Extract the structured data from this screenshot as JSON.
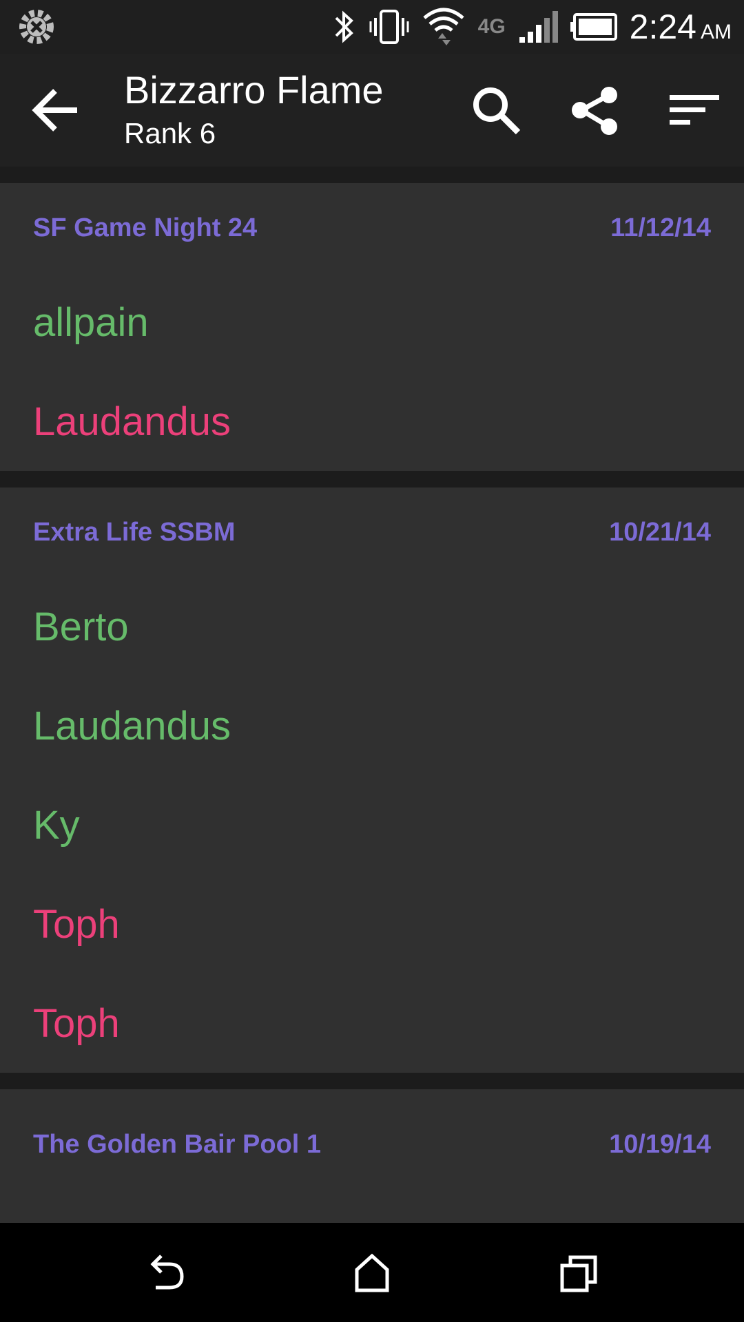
{
  "status_bar": {
    "time": "2:24",
    "ampm": "AM",
    "network_label": "4G"
  },
  "app_bar": {
    "title": "Bizzarro Flame",
    "subtitle": "Rank 6"
  },
  "tournaments": [
    {
      "name": "SF Game Night 24",
      "date": "11/12/14",
      "matches": [
        {
          "opponent": "allpain",
          "result": "win"
        },
        {
          "opponent": "Laudandus",
          "result": "loss"
        }
      ]
    },
    {
      "name": "Extra Life SSBM",
      "date": "10/21/14",
      "matches": [
        {
          "opponent": "Berto",
          "result": "win"
        },
        {
          "opponent": "Laudandus",
          "result": "win"
        },
        {
          "opponent": "Ky",
          "result": "win"
        },
        {
          "opponent": "Toph",
          "result": "loss"
        },
        {
          "opponent": "Toph",
          "result": "loss"
        }
      ]
    },
    {
      "name": "The Golden Bair Pool 1",
      "date": "10/19/14",
      "matches": []
    }
  ],
  "colors": {
    "accent": "#7c6bd6",
    "win": "#66bb6a",
    "loss": "#ec407a"
  },
  "icons": [
    "settings-app-icon",
    "bluetooth-icon",
    "vibrate-icon",
    "wifi-icon",
    "signal-icon",
    "battery-icon",
    "back-arrow-icon",
    "search-icon",
    "share-icon",
    "sort-icon",
    "nav-back-icon",
    "nav-home-icon",
    "nav-recents-icon"
  ]
}
